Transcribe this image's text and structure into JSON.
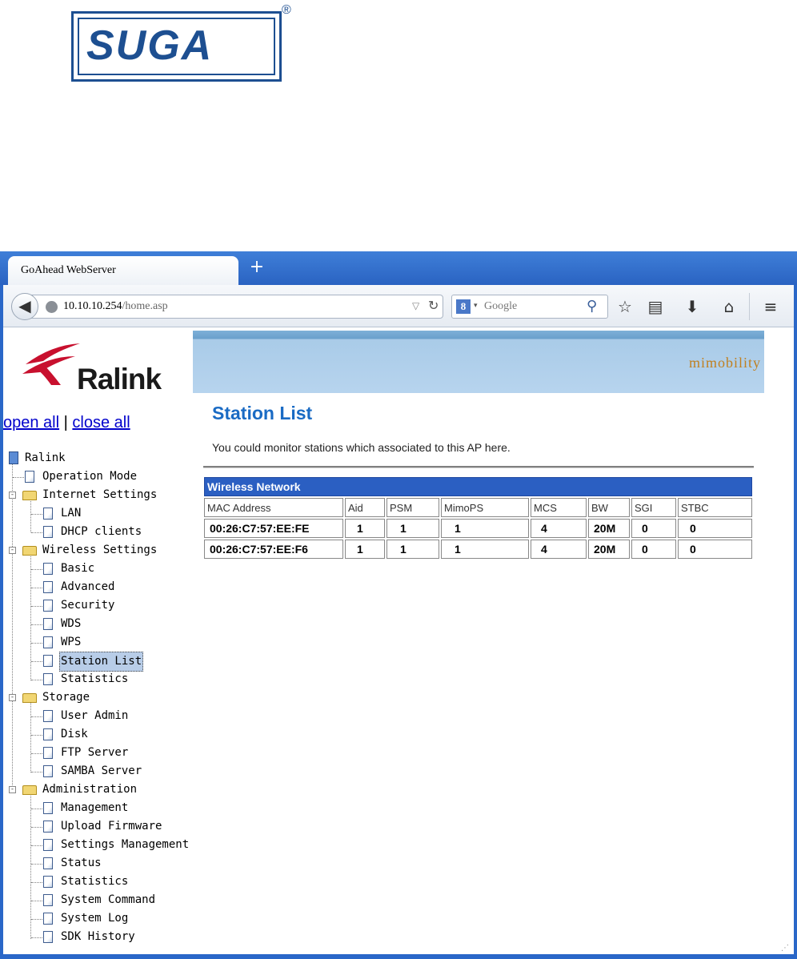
{
  "doc_logo": {
    "text": "SUGA",
    "reg_mark": "®"
  },
  "browser": {
    "tab_title": "GoAhead WebServer",
    "new_tab": "+",
    "url_host": "10.10.10.254",
    "url_path": "/home.asp",
    "search_engine": "8",
    "search_placeholder": "Google"
  },
  "left_frame": {
    "logo_text": "Ralink",
    "open_all": "open all",
    "separator": "|",
    "close_all": "close all",
    "tree": {
      "root": "Ralink",
      "operation_mode": "Operation Mode",
      "internet_settings": "Internet Settings",
      "lan": "LAN",
      "dhcp_clients": "DHCP clients",
      "wireless_settings": "Wireless Settings",
      "basic": "Basic",
      "advanced": "Advanced",
      "security": "Security",
      "wds": "WDS",
      "wps": "WPS",
      "station_list": "Station List",
      "statistics_wireless": "Statistics",
      "storage": "Storage",
      "user_admin": "User Admin",
      "disk": "Disk",
      "ftp_server": "FTP Server",
      "samba_server": "SAMBA Server",
      "administration": "Administration",
      "management": "Management",
      "upload_firmware": "Upload Firmware",
      "settings_management": "Settings Management",
      "status": "Status",
      "statistics_admin": "Statistics",
      "system_command": "System Command",
      "system_log": "System Log",
      "sdk_history": "SDK History"
    }
  },
  "main": {
    "banner_text": "mimobility",
    "title": "Station List",
    "description": "You could monitor stations which associated to this AP here.",
    "table": {
      "caption": "Wireless Network",
      "headers": [
        "MAC Address",
        "Aid",
        "PSM",
        "MimoPS",
        "MCS",
        "BW",
        "SGI",
        "STBC"
      ],
      "rows": [
        [
          "00:26:C7:57:EE:FE",
          "1",
          "1",
          "1",
          "4",
          "20M",
          "0",
          "0"
        ],
        [
          "00:26:C7:57:EE:F6",
          "1",
          "1",
          "1",
          "4",
          "20M",
          "0",
          "0"
        ]
      ]
    }
  },
  "colors": {
    "suga_blue": "#1d4f91",
    "title_blue": "#1a6bc4",
    "table_header_blue": "#2b5fc2",
    "browser_chrome_blue": "#2a67c8"
  }
}
